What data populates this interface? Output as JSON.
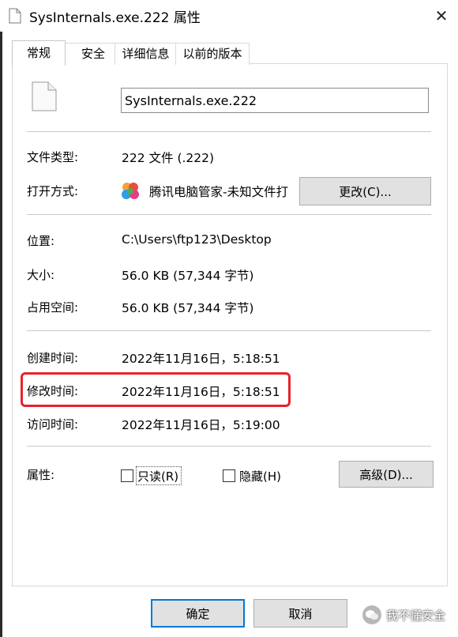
{
  "window": {
    "title": "SysInternals.exe.222 属性",
    "close_symbol": "✕"
  },
  "tabs": [
    {
      "label": "常规",
      "active": true
    },
    {
      "label": "安全",
      "active": false
    },
    {
      "label": "详细信息",
      "active": false
    },
    {
      "label": "以前的版本",
      "active": false
    }
  ],
  "file": {
    "name": "SysInternals.exe.222"
  },
  "props": {
    "type_label": "文件类型:",
    "type_value": "222 文件 (.222)",
    "open_label": "打开方式:",
    "open_value": "腾讯电脑管家-未知文件打",
    "change_button": "更改(C)...",
    "location_label": "位置:",
    "location_value": "C:\\Users\\ftp123\\Desktop",
    "size_label": "大小:",
    "size_value": "56.0 KB (57,344 字节)",
    "disk_label": "占用空间:",
    "disk_value": "56.0 KB (57,344 字节)",
    "created_label": "创建时间:",
    "created_value": "2022年11月16日，5:18:51",
    "modified_label": "修改时间:",
    "modified_value": "2022年11月16日，5:18:51",
    "accessed_label": "访问时间:",
    "accessed_value": "2022年11月16日，5:19:00",
    "attributes_label": "属性:",
    "readonly_label": "只读(R)",
    "readonly_checked": false,
    "hidden_label": "隐藏(H)",
    "hidden_checked": false,
    "advanced_button": "高级(D)..."
  },
  "footer": {
    "ok_button": "确定",
    "cancel_button": "取消"
  },
  "watermark": {
    "text": "我不懂安全"
  },
  "colors": {
    "highlight": "#e5242b",
    "ok_border": "#0078d7"
  }
}
